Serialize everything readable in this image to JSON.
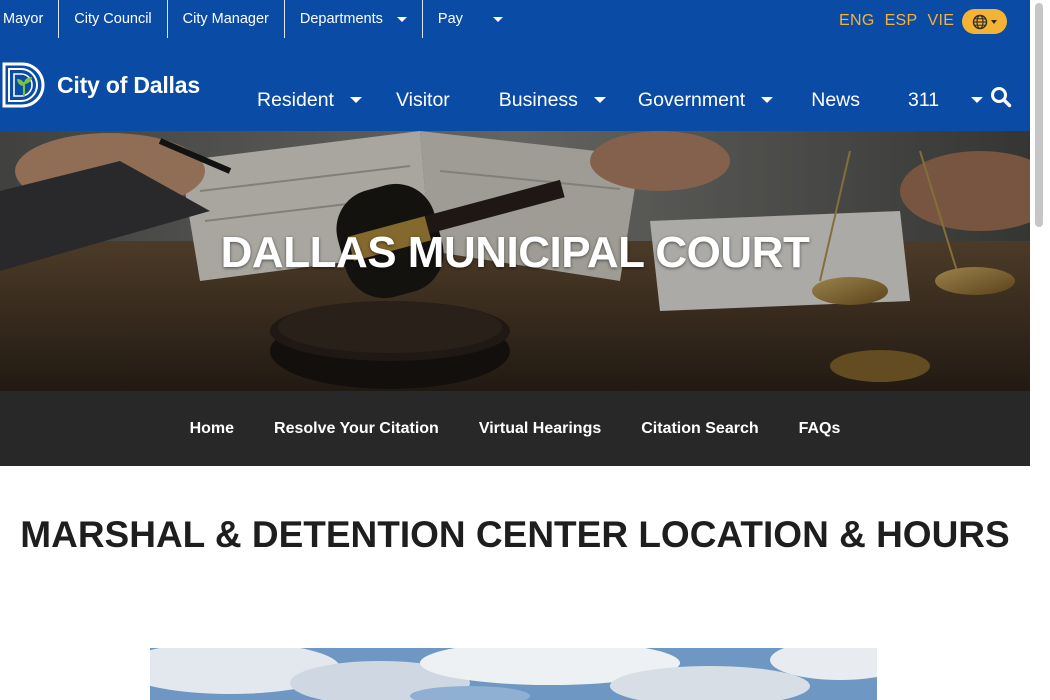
{
  "utility_nav": {
    "items": [
      {
        "label": "Mayor"
      },
      {
        "label": "City Council"
      },
      {
        "label": "City Manager"
      },
      {
        "label": "Departments"
      },
      {
        "label": "Pay"
      }
    ]
  },
  "languages": [
    "ENG",
    "ESP",
    "VIE"
  ],
  "translate": {
    "icon": "translate-globe-icon"
  },
  "logo": {
    "text": "City of Dallas",
    "icon": "city-of-dallas-d-logo"
  },
  "main_nav": {
    "items": [
      {
        "label": "Resident"
      },
      {
        "label": "Visitor"
      },
      {
        "label": "Business"
      },
      {
        "label": "Government"
      },
      {
        "label": "News"
      },
      {
        "label": "311"
      }
    ],
    "search_icon": "search-icon"
  },
  "hero": {
    "title": "DALLAS MUNICIPAL COURT"
  },
  "court_nav": {
    "items": [
      {
        "label": "Home"
      },
      {
        "label": "Resolve Your Citation"
      },
      {
        "label": "Virtual Hearings"
      },
      {
        "label": "Citation Search"
      },
      {
        "label": "FAQs"
      }
    ]
  },
  "page": {
    "title": "MARSHAL & DETENTION CENTER LOCATION & HOURS"
  },
  "colors": {
    "header_blue": "#0a4ba5",
    "accent_gold": "#f5b335",
    "subnav_dark": "#282828",
    "title_text": "#1e1e1e"
  }
}
